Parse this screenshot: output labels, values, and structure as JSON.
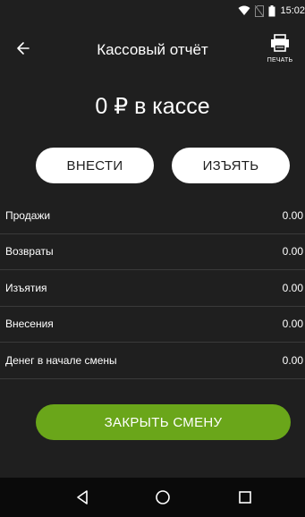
{
  "status_bar": {
    "time": "15:02",
    "icons": [
      "wifi-icon",
      "no-sim-icon",
      "battery-icon"
    ]
  },
  "header": {
    "title": "Кассовый отчёт",
    "back_icon": "arrow-left-icon",
    "print_icon": "printer-icon",
    "print_label": "ПЕЧАТЬ"
  },
  "balance": {
    "text": "0 ₽ в кассе"
  },
  "actions": {
    "deposit_label": "ВНЕСТИ",
    "withdraw_label": "ИЗЪЯТЬ"
  },
  "report": {
    "rows": [
      {
        "label": "Продажи",
        "value": "0.00"
      },
      {
        "label": "Возвраты",
        "value": "0.00"
      },
      {
        "label": "Изъятия",
        "value": "0.00"
      },
      {
        "label": "Внесения",
        "value": "0.00"
      },
      {
        "label": "Денег в начале смены",
        "value": "0.00"
      }
    ]
  },
  "close_shift": {
    "label": "ЗАКРЫТЬ СМЕНУ"
  },
  "colors": {
    "background": "#1f1f1f",
    "accent_green": "#6aa61a",
    "button_white": "#ffffff"
  },
  "nav_bar": {
    "icons": [
      "nav-back-icon",
      "nav-home-icon",
      "nav-recents-icon"
    ]
  }
}
